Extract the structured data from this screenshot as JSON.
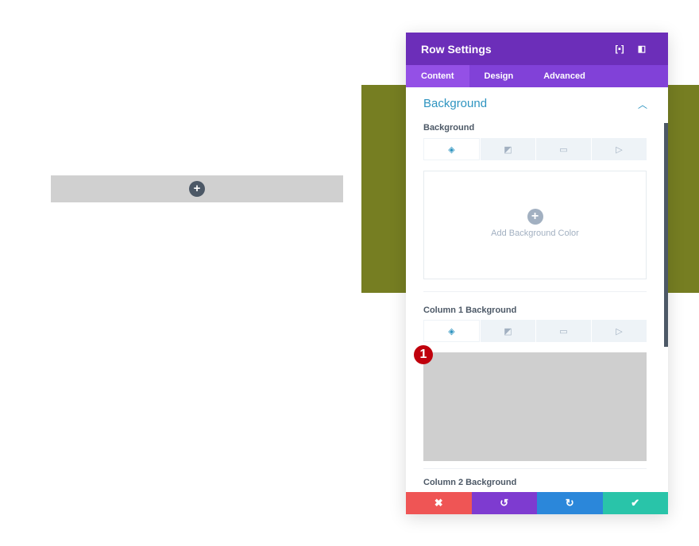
{
  "canvas": {
    "add_icon": "+"
  },
  "panel": {
    "title": "Row Settings",
    "header_icons": [
      "fullscreen-icon",
      "sidebar-icon"
    ],
    "tabs": [
      {
        "label": "Content"
      },
      {
        "label": "Design"
      },
      {
        "label": "Advanced"
      }
    ],
    "section_title": "Background",
    "background": {
      "label": "Background",
      "add_label": "Add Background Color",
      "plus": "+"
    },
    "column1": {
      "label": "Column 1 Background",
      "badge": "1"
    },
    "column2": {
      "label": "Column 2 Background"
    },
    "footer": {
      "cancel": "✖",
      "undo": "↺",
      "redo": "↻",
      "save": "✔"
    },
    "colors": {
      "header": "#6c2eb9",
      "tabs": "#8141d8",
      "accent": "#2e94c0",
      "olive": "#767e22",
      "cancel": "#ef5555",
      "undo": "#7e3bd0",
      "redo": "#2b87da",
      "save": "#29c4a9"
    }
  }
}
